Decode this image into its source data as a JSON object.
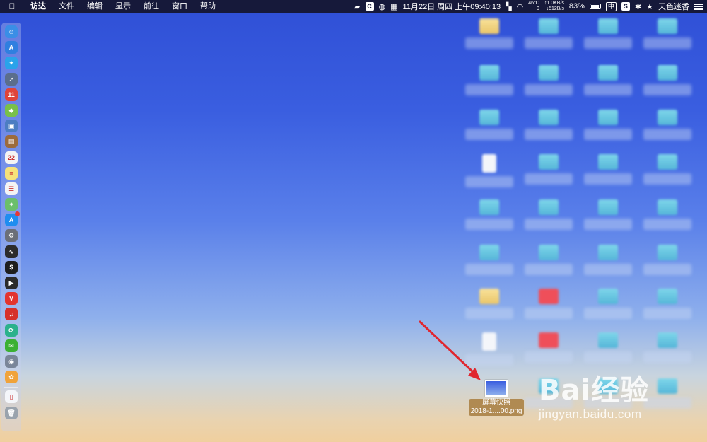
{
  "menubar": {
    "apple": "",
    "app_name": "访达",
    "menus": [
      "文件",
      "编辑",
      "显示",
      "前往",
      "窗口",
      "帮助"
    ],
    "status": {
      "c_badge": "C",
      "datetime": "11月22日 周四 上午09:40:13",
      "temp": "46°C",
      "cpu": "0",
      "up": "↑1.0KB/s",
      "down": "↓512B/s",
      "battery": "83%",
      "battery_level": 0.83,
      "ime": "中",
      "s_badge": "S",
      "bluetooth": "✱",
      "star": "★",
      "user": "天色迷香"
    }
  },
  "dock": {
    "items": [
      {
        "name": "finder-icon",
        "glyph": "☺",
        "color": "#3a8ee6"
      },
      {
        "name": "app-store-icon",
        "glyph": "A",
        "color": "#2f7fe0"
      },
      {
        "name": "safari-icon",
        "glyph": "✦",
        "color": "#2aa3ea"
      },
      {
        "name": "launchpad-icon",
        "glyph": "➚",
        "color": "#5b6e8c"
      },
      {
        "name": "calendar-red-icon",
        "glyph": "11",
        "color": "#e0443a"
      },
      {
        "name": "android-icon",
        "glyph": "◆",
        "color": "#79c04a"
      },
      {
        "name": "preview-icon",
        "glyph": "▣",
        "color": "#4c7dc2"
      },
      {
        "name": "notebook-icon",
        "glyph": "▤",
        "color": "#9c6b3c"
      },
      {
        "name": "calendar-icon",
        "glyph": "22",
        "color": "#f4f4f4"
      },
      {
        "name": "notes-icon",
        "glyph": "≡",
        "color": "#f6e27a"
      },
      {
        "name": "reminders-icon",
        "glyph": "☰",
        "color": "#f4f4f4"
      },
      {
        "name": "maps-icon",
        "glyph": "⌖",
        "color": "#6bbf6a"
      },
      {
        "name": "app-store-updates-icon",
        "glyph": "A",
        "color": "#1f8df0",
        "badge": true
      },
      {
        "name": "system-preferences-icon",
        "glyph": "⚙",
        "color": "#6b6f78"
      },
      {
        "name": "activity-monitor-icon",
        "glyph": "∿",
        "color": "#2c2c2c"
      },
      {
        "name": "terminal-icon",
        "glyph": "$",
        "color": "#1e1e1e"
      },
      {
        "name": "console-icon",
        "glyph": "▶",
        "color": "#2b2b2b"
      },
      {
        "name": "vivaldi-icon",
        "glyph": "V",
        "color": "#e3342f"
      },
      {
        "name": "netease-music-icon",
        "glyph": "♫",
        "color": "#d6312b"
      },
      {
        "name": "sync-icon",
        "glyph": "⟳",
        "color": "#2bb18c"
      },
      {
        "name": "wechat-icon",
        "glyph": "✉",
        "color": "#3cb034"
      },
      {
        "name": "screenshot-tool-icon",
        "glyph": "◉",
        "color": "#7a8699"
      },
      {
        "name": "photos-icon",
        "glyph": "✿",
        "color": "#f0a33a"
      },
      {
        "name": "document-icon",
        "glyph": "▯",
        "color": "#f4f6fa"
      },
      {
        "name": "trash-icon",
        "glyph": "🗑",
        "color": "#9aa3ad"
      }
    ]
  },
  "screenshot_file": {
    "line1": "屏幕快照",
    "line2": "2018-1....00.png"
  },
  "watermark": {
    "brand": "Bai经验",
    "url": "jingyan.baidu.com"
  }
}
